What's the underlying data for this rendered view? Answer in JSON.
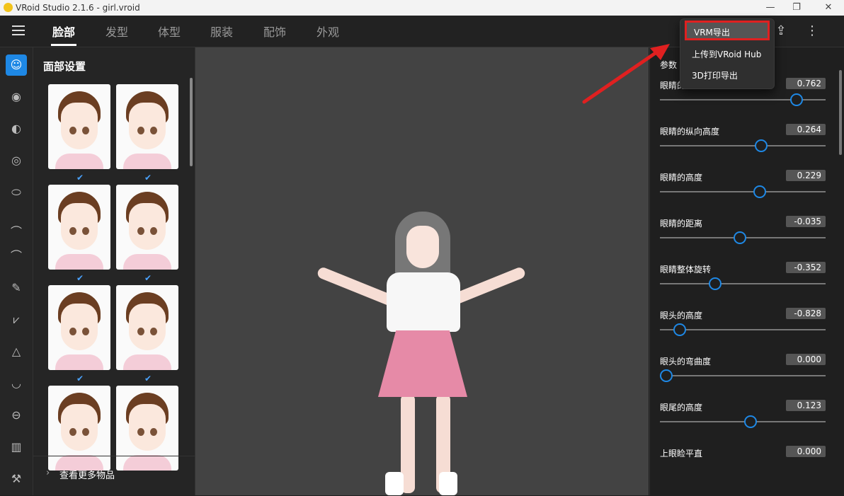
{
  "window": {
    "title": "VRoid Studio 2.1.6 - girl.vroid"
  },
  "tabs": [
    {
      "label": "脸部",
      "active": true
    },
    {
      "label": "发型"
    },
    {
      "label": "体型"
    },
    {
      "label": "服装"
    },
    {
      "label": "配饰"
    },
    {
      "label": "外观"
    }
  ],
  "left_panel": {
    "title": "面部设置",
    "more_label": "查看更多物品",
    "more_icon": "chevron-right-icon"
  },
  "left_rail_icons": [
    "face-icon",
    "eye-icon",
    "iris-icon",
    "eye-white-icon",
    "eyelid-icon",
    "eyebrow-icon",
    "eyelash-icon",
    "eyeliner-icon",
    "lower-eyelash-icon",
    "nose-icon",
    "mouth-icon",
    "lip-icon",
    "body-icon",
    "tool-icon"
  ],
  "dropdown": {
    "items": [
      {
        "label": "VRM导出",
        "highlighted": true
      },
      {
        "label": "上传到VRoid Hub"
      },
      {
        "label": "3D打印导出"
      }
    ]
  },
  "right_panel": {
    "header": "参数",
    "params": [
      {
        "label": "眼睛的",
        "value": "0.762",
        "knob": 0.85
      },
      {
        "label": "眼睛的纵向高度",
        "value": "0.264",
        "knob": 0.62
      },
      {
        "label": "眼睛的高度",
        "value": "0.229",
        "knob": 0.61
      },
      {
        "label": "眼睛的距离",
        "value": "-0.035",
        "knob": 0.48
      },
      {
        "label": "眼睛整体旋转",
        "value": "-0.352",
        "knob": 0.32
      },
      {
        "label": "眼头的高度",
        "value": "-0.828",
        "knob": 0.09
      },
      {
        "label": "眼头的弯曲度",
        "value": "0.000",
        "knob": 0.0
      },
      {
        "label": "眼尾的高度",
        "value": "0.123",
        "knob": 0.55
      },
      {
        "label": "上眼睑平直",
        "value": "0.000",
        "knob": 0.5
      }
    ]
  },
  "colors": {
    "accent": "#1e88e5",
    "highlight_border": "#e02020"
  }
}
